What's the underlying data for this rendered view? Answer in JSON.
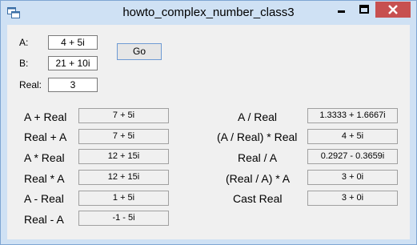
{
  "window": {
    "title": "howto_complex_number_class3"
  },
  "inputs": {
    "a": {
      "label": "A:",
      "value": "4 + 5i"
    },
    "b": {
      "label": "B:",
      "value": "21 + 10i"
    },
    "real": {
      "label": "Real:",
      "value": "3"
    }
  },
  "go_label": "Go",
  "results_left": [
    {
      "label": "A + Real",
      "value": "7 + 5i"
    },
    {
      "label": "Real + A",
      "value": "7 + 5i"
    },
    {
      "label": "A * Real",
      "value": "12 + 15i"
    },
    {
      "label": "Real * A",
      "value": "12 + 15i"
    },
    {
      "label": "A - Real",
      "value": "1 + 5i"
    },
    {
      "label": "Real - A",
      "value": "-1 - 5i"
    }
  ],
  "results_right": [
    {
      "label": "A / Real",
      "value": "1.3333 + 1.6667i"
    },
    {
      "label": "(A / Real) * Real",
      "value": "4 + 5i"
    },
    {
      "label": "Real / A",
      "value": "0.2927 - 0.3659i"
    },
    {
      "label": "(Real / A) * A",
      "value": "3 + 0i"
    },
    {
      "label": "Cast Real",
      "value": "3 + 0i"
    }
  ]
}
